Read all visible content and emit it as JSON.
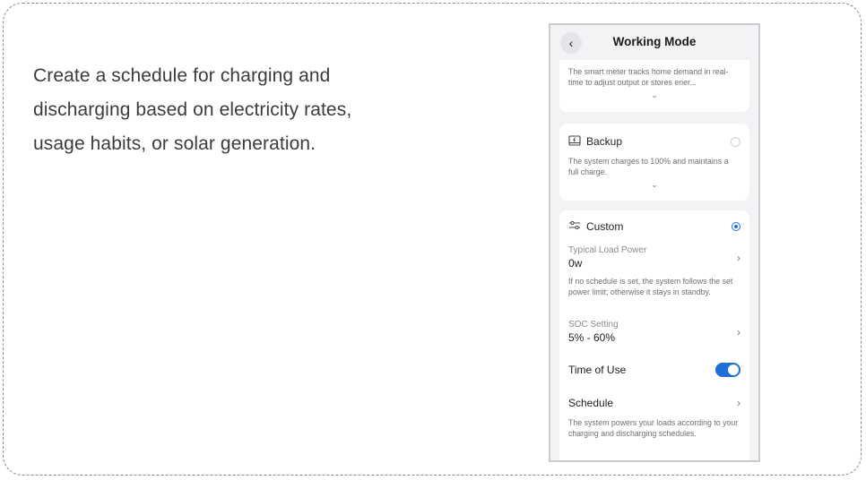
{
  "description": "Create a schedule for charging and discharging based on electricity rates, usage habits, or solar generation.",
  "header": {
    "back_icon": "chevron-left-icon",
    "title": "Working Mode"
  },
  "self_consumption": {
    "description": "The smart meter tracks home demand in real-time to adjust output or stores ener...",
    "expand_icon": "chevron-down-icon"
  },
  "backup": {
    "icon": "battery-box-icon",
    "label": "Backup",
    "selected": false,
    "description": "The system charges to 100% and maintains a full charge.",
    "expand_icon": "chevron-down-icon"
  },
  "custom": {
    "icon": "sliders-icon",
    "label": "Custom",
    "selected": true,
    "typical_load_power": {
      "label": "Typical Load Power",
      "value": "0w",
      "note": "If no schedule is set, the system follows the set power limit; otherwise it stays in standby."
    },
    "soc_setting": {
      "label": "SOC Setting",
      "value": "5% - 60%"
    },
    "time_of_use": {
      "label": "Time of Use",
      "enabled": true
    },
    "schedule": {
      "label": "Schedule",
      "note": "The system powers your loads according to your charging and discharging schedules."
    }
  },
  "colors": {
    "accent": "#1f6fd6",
    "background": "#f2f3f5"
  }
}
